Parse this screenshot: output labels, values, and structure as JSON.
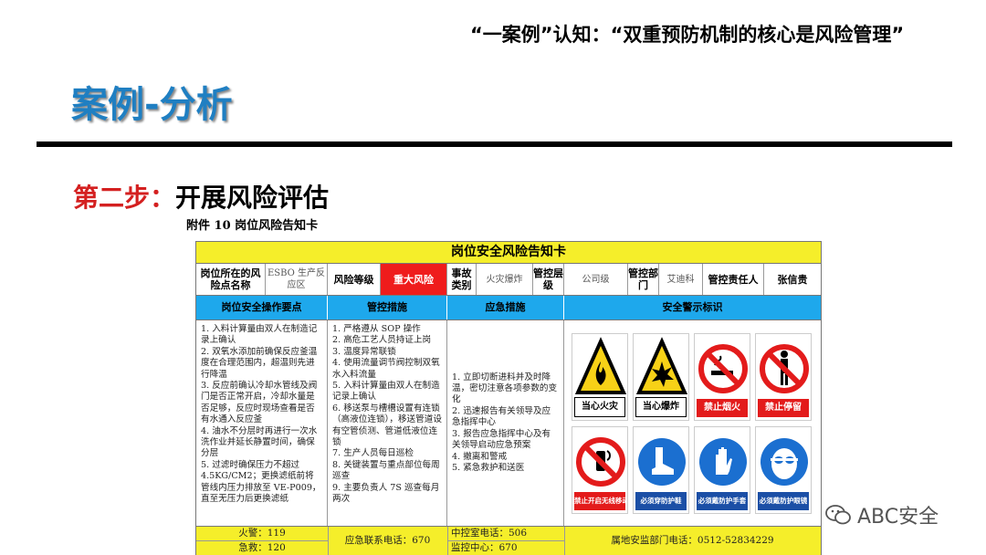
{
  "header": {
    "caption": "“一案例”认知：“双重预防机制的核心是风险管理”",
    "title": "案例-分析",
    "step_lead": "第二步：",
    "step_rest": "开展风险评估",
    "attachment": "附件 10  岗位风险告知卡"
  },
  "card": {
    "title": "岗位安全风险告知卡",
    "info": {
      "post_label": "岗位所在的风险点名称",
      "post_value": "ESBO 生产反应区",
      "level_label": "风险等级",
      "level_value": "重大风险",
      "incident_label": "事故类别",
      "incident_value": "火灾爆炸",
      "control_level_label": "管控层级",
      "control_level_value": "公司级",
      "dept_label": "管控部门",
      "dept_value": "艾迪科",
      "owner_label": "管控责任人",
      "owner_value": "张信贵"
    },
    "headers": {
      "ops": "岗位安全操作要点",
      "measures": "管控措施",
      "emergency": "应急措施",
      "signs": "安全警示标识"
    },
    "ops": [
      "1. 入料计算量由双人在制造记录上确认",
      "2. 双氧水添加前确保反应釜温度在合理范围内，超温则先进行降温",
      "3. 反应前确认冷却水管线及阀门是否正常开启，冷却水量是否足够，反应时现场查看是否有水通入反应釜",
      "4. 油水不分层时再进行一次水洗作业并延长静置时间，确保分层",
      "5. 过滤时确保压力不超过 4.5KG/CM2；更换滤纸前将管线内压力排放至 VE-P009，直至无压力后更换滤纸"
    ],
    "measures": [
      "1. 严格遵从 SOP 操作",
      "2. 高危工艺人员持证上岗",
      "3. 温度异常联锁",
      "4. 使用流量调节阀控制双氧水入料流量",
      "5. 入料计算量由双人在制造记录上确认",
      "6. 移送泵与槽槽设置有连锁（高液位连锁），移送管道设有空管侦测、管道低液位连锁",
      "7. 生产人员每日巡检",
      "8. 关键装置与重点部位每周巡查",
      "9. 主要负责人 7S 巡查每月两次"
    ],
    "emergency": [
      "1. 立即切断进料并及时降温，密切注意各项参数的变化",
      "2. 迅速报告有关领导及应急指挥中心",
      "3. 报告应急指挥中心及有关领导启动应急预案",
      "4. 撤离和警戒",
      "5. 紧急救护和送医"
    ],
    "signs": [
      {
        "icon": "fire-warning-icon",
        "label": "当心火灾"
      },
      {
        "icon": "explosion-warning-icon",
        "label": "当心爆炸"
      },
      {
        "icon": "no-smoking-icon",
        "label": "禁止烟火"
      },
      {
        "icon": "no-loitering-icon",
        "label": "禁止停留"
      },
      {
        "icon": "no-phone-icon",
        "label": "禁止开启无线移动通讯设备"
      },
      {
        "icon": "safety-shoes-icon",
        "label": "必须穿防护鞋"
      },
      {
        "icon": "gloves-icon",
        "label": "必须戴防护手套"
      },
      {
        "icon": "goggles-icon",
        "label": "必须戴防护眼镜"
      }
    ],
    "footer": {
      "fire": "火警：119",
      "ambulance": "急救：120",
      "emergency_phone": "应急联系电话：670",
      "control_room": "中控室电话：506",
      "monitor_center": "监控中心：670",
      "supervision": "属地安监部门电话：0512-52834229"
    }
  },
  "watermark": {
    "text": "ABC安全"
  },
  "colors": {
    "title_blue": "#1f7fc2",
    "card_yellow": "#f5ee2a",
    "header_blue": "#1ea8ec",
    "risk_red": "#ef1c1c"
  }
}
